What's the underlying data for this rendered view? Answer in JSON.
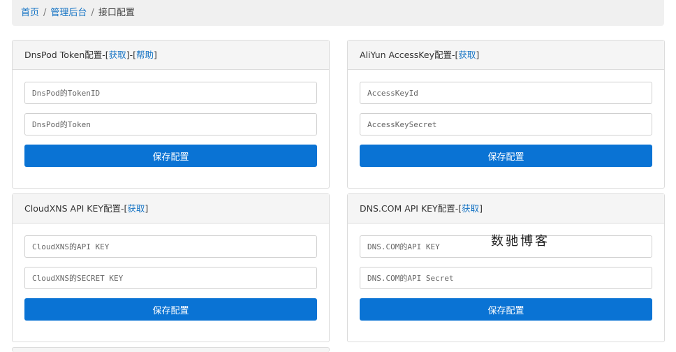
{
  "breadcrumb": {
    "home": "首页",
    "sep1": "/",
    "admin": "管理后台",
    "sep2": "/",
    "current": "接口配置"
  },
  "panels": {
    "dnspod": {
      "title": "DnsPod Token配置",
      "dash1": "-[",
      "link1": "获取",
      "mid": "]-[",
      "link2": "帮助",
      "end": "]",
      "field1_placeholder": "DnsPod的TokenID",
      "field2_placeholder": "DnsPod的Token",
      "save_label": "保存配置"
    },
    "aliyun": {
      "title": "AliYun AccessKey配置",
      "dash1": "-[",
      "link1": "获取",
      "end": "]",
      "field1_placeholder": "AccessKeyId",
      "field2_placeholder": "AccessKeySecret",
      "save_label": "保存配置"
    },
    "cloudxns": {
      "title": "CloudXNS API KEY配置",
      "dash1": "-[",
      "link1": "获取",
      "end": "]",
      "field1_placeholder": "CloudXNS的API KEY",
      "field2_placeholder": "CloudXNS的SECRET KEY",
      "save_label": "保存配置"
    },
    "dnscom": {
      "title": "DNS.COM API KEY配置",
      "dash1": "-[",
      "link1": "获取",
      "end": "]",
      "field1_placeholder": "DNS.COM的API KEY",
      "field2_placeholder": "DNS.COM的API Secret",
      "save_label": "保存配置"
    }
  },
  "watermark": "数驰博客",
  "colors": {
    "accent": "#0a73d4",
    "link": "#1573c4"
  }
}
